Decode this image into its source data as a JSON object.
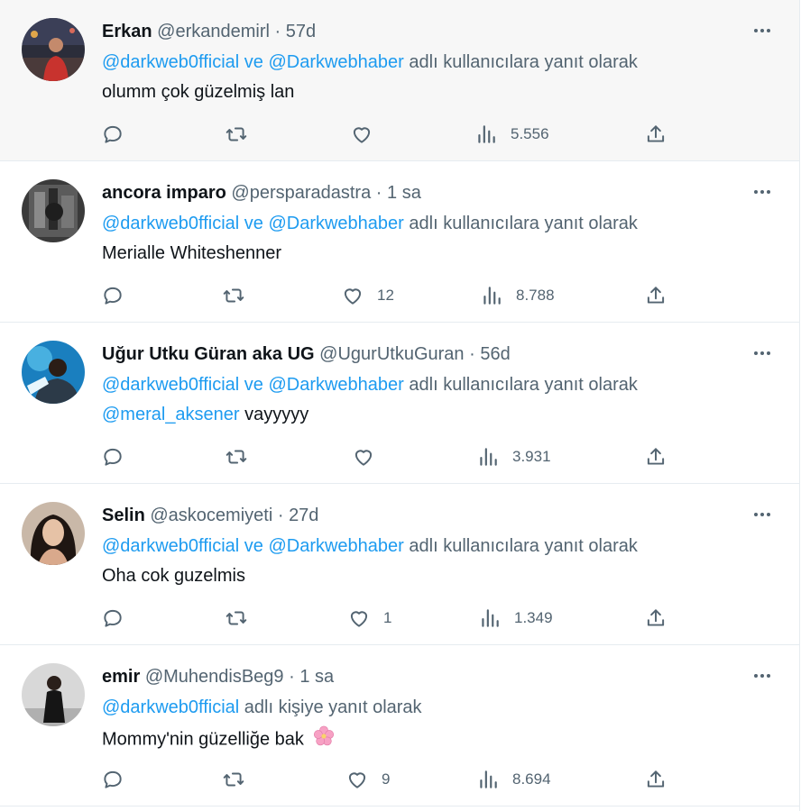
{
  "tweets": [
    {
      "name": "Erkan",
      "handle": "@erkandemirl",
      "dot": "·",
      "time": "57d",
      "mention1": "@darkweb0fficial ve @Darkwebhaber",
      "mention2": "",
      "reply_suffix": "adlı kullanıcılara yanıt olarak",
      "body_mention": "",
      "body": "olumm çok güzelmiş lan",
      "likes": "",
      "views": "5.556",
      "hovered": true
    },
    {
      "name": "ancora imparo",
      "handle": "@persparadastra",
      "dot": "·",
      "time": "1 sa",
      "mention1": "@darkweb0fficial ve @Darkwebhaber",
      "mention2": "",
      "reply_suffix": "adlı kullanıcılara yanıt olarak",
      "body_mention": "",
      "body": "Merialle Whiteshenner",
      "likes": "12",
      "views": "8.788"
    },
    {
      "name": "Uğur Utku Güran aka UG",
      "handle": "@UgurUtkuGuran",
      "dot": "·",
      "time": "56d",
      "mention1": "@darkweb0fficial ve @Darkwebhaber",
      "mention2": "",
      "reply_suffix": "adlı kullanıcılara yanıt olarak",
      "body_mention": "@meral_aksener",
      "body": "vayyyyy",
      "likes": "",
      "views": "3.931"
    },
    {
      "name": "Selin",
      "handle": "@askocemiyeti",
      "dot": "·",
      "time": "27d",
      "mention1": "@darkweb0fficial ve @Darkwebhaber",
      "mention2": "",
      "reply_suffix": "adlı kullanıcılara yanıt olarak",
      "body_mention": "",
      "body": "Oha cok guzelmis",
      "likes": "1",
      "views": "1.349"
    },
    {
      "name": "emir",
      "handle": "@MuhendisBeg9",
      "dot": "·",
      "time": "1 sa",
      "mention1": "@darkweb0fficial",
      "mention2": "",
      "reply_suffix": "adlı kişiye yanıt olarak",
      "body_mention": "",
      "body": "Mommy'nin güzelliğe bak",
      "likes": "9",
      "views": "8.694"
    }
  ],
  "icons": {
    "reply": "reply-icon",
    "retweet": "retweet-icon",
    "like": "heart-icon",
    "views": "views-icon",
    "share": "share-icon",
    "more": "more-icon",
    "emoji": "cherry-blossom-emoji"
  },
  "colors": {
    "link": "#1d9bf0",
    "muted": "#536471",
    "text": "#0f1419",
    "hover_bg": "#f7f7f7"
  }
}
